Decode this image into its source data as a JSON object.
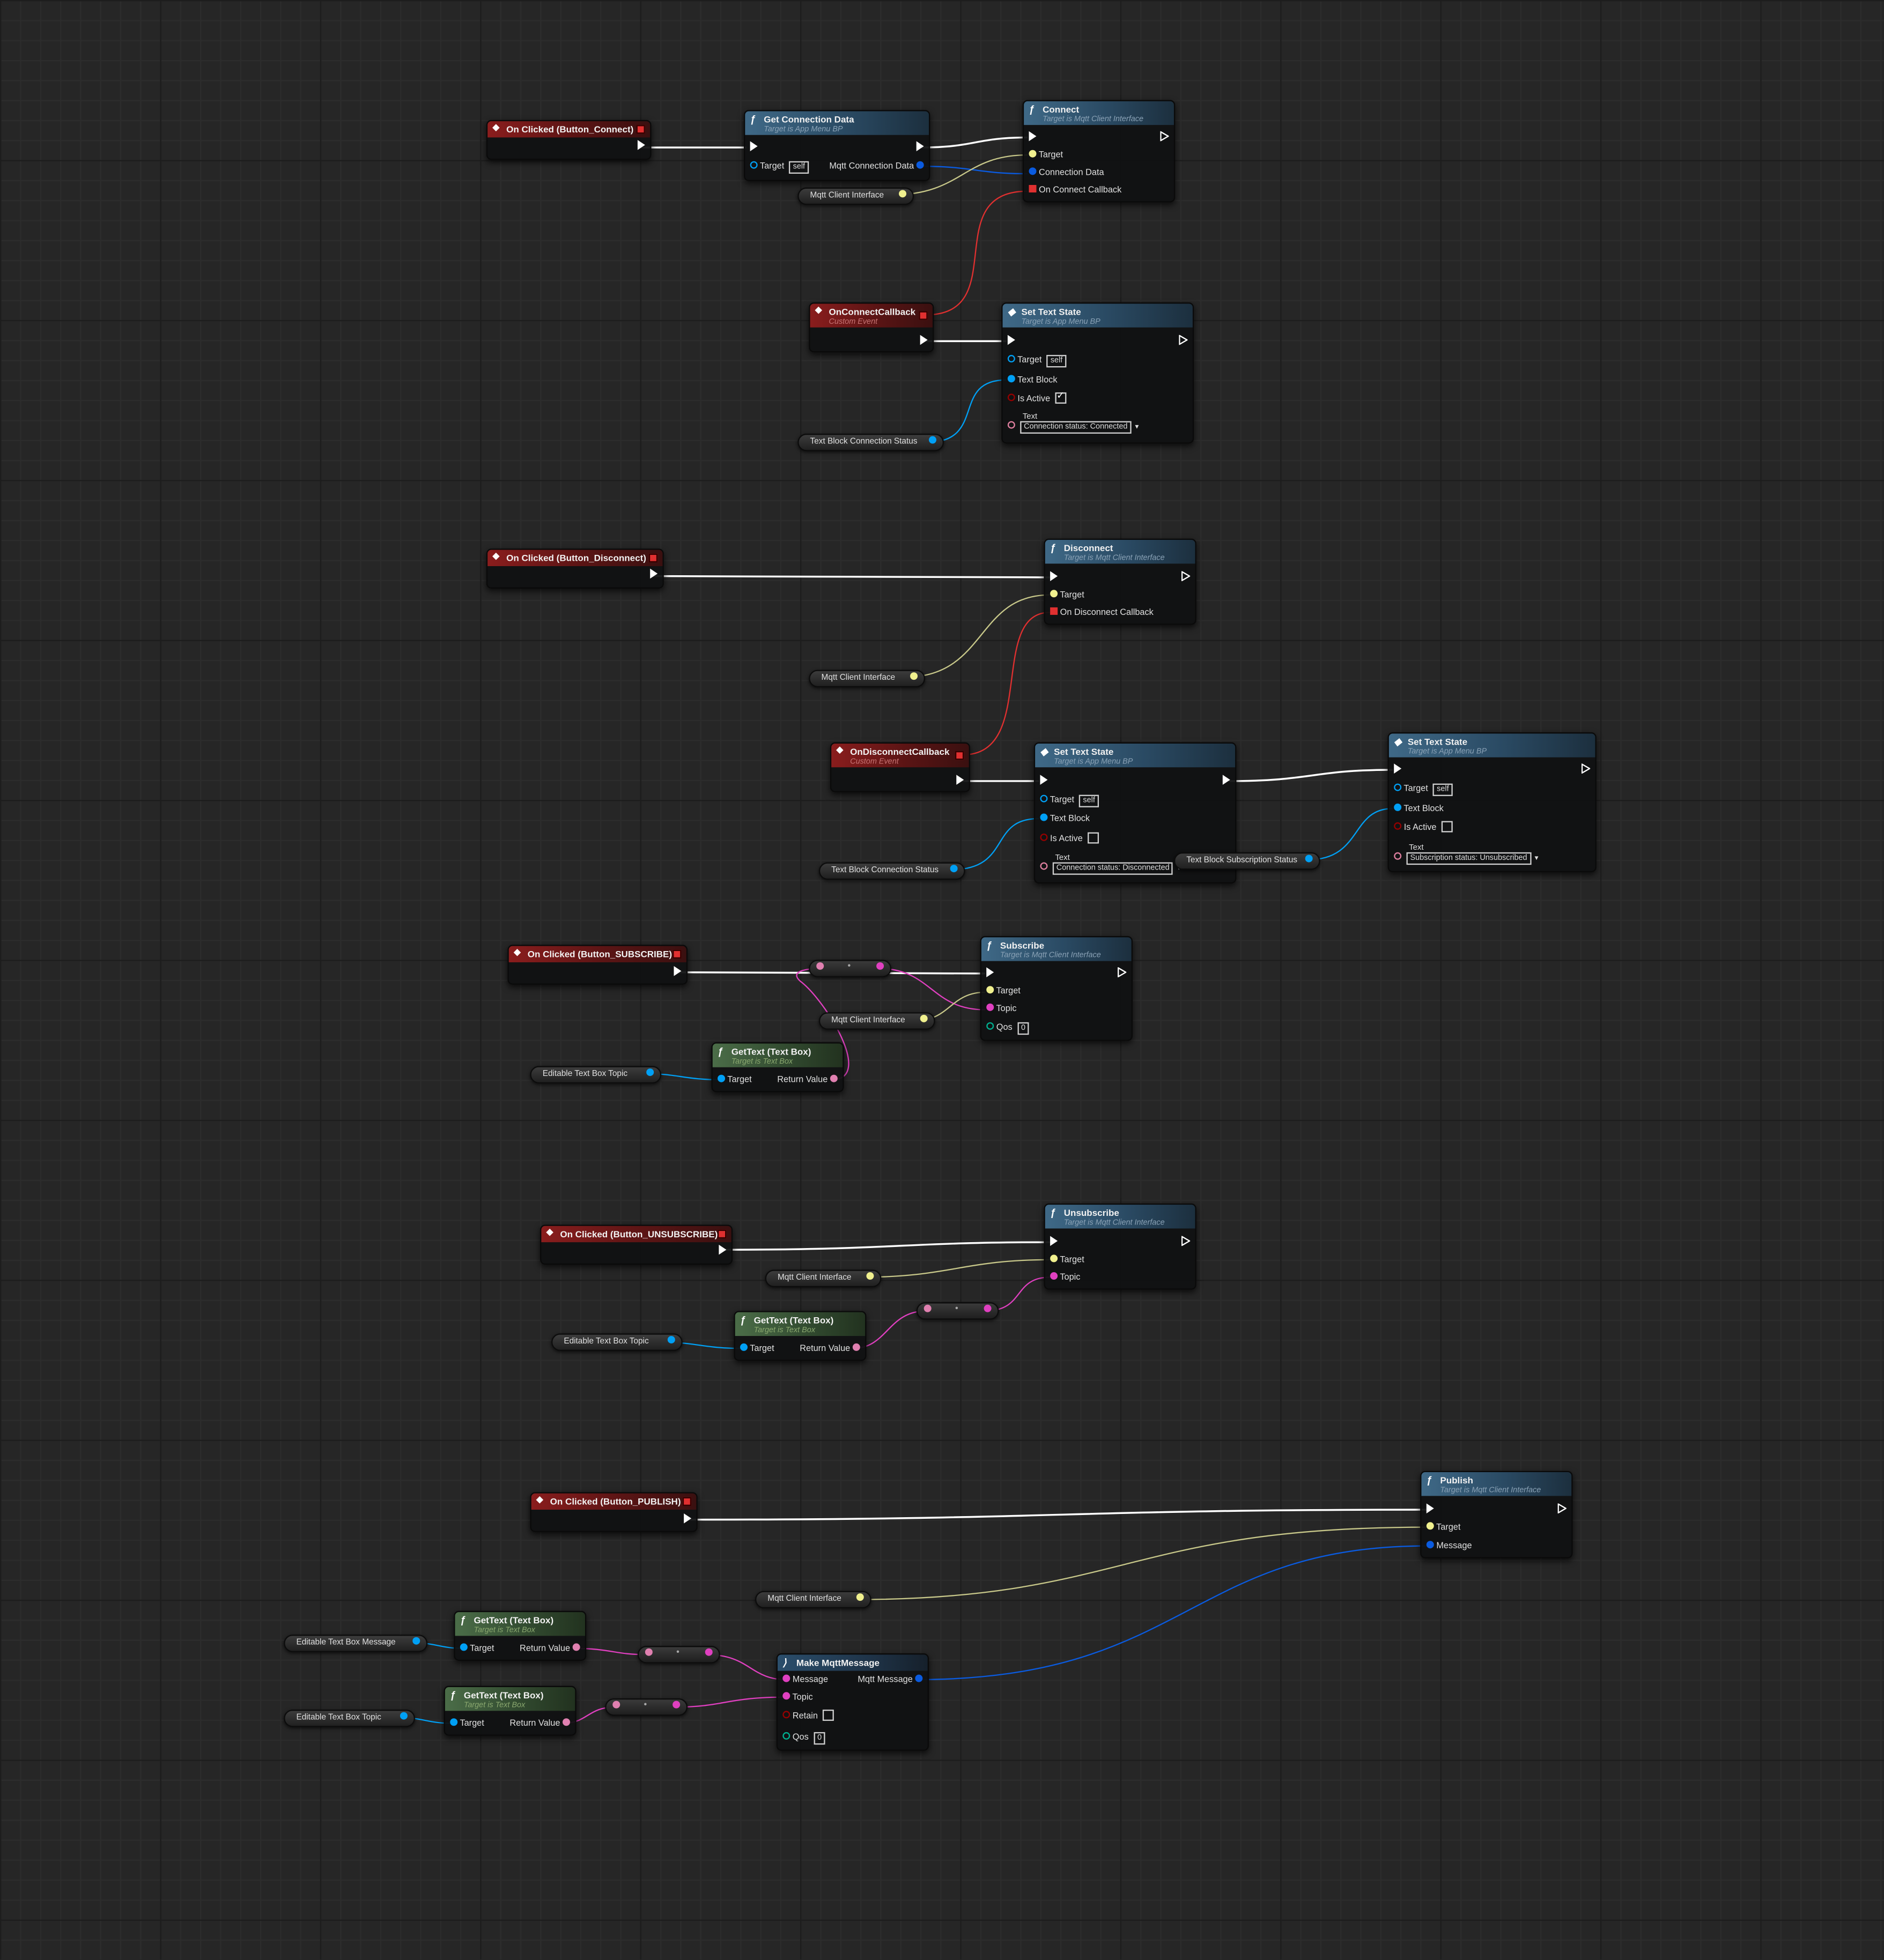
{
  "colors": {
    "exec": "#ffffff",
    "object": "#00a0f5",
    "interface": "#f0f08e",
    "struct": "#0a5be0",
    "delegate": "#e03030",
    "text": "#e040c0",
    "bool": "#950000",
    "byte": "#006060"
  },
  "nodes": {
    "ev_connect": {
      "title": "On Clicked (Button_Connect)"
    },
    "get_conn": {
      "title": "Get Connection Data",
      "subtitle": "Target is App Menu BP",
      "target": "Target",
      "self": "self",
      "out": "Mqtt Connection Data"
    },
    "connect": {
      "title": "Connect",
      "subtitle": "Target is Mqtt Client Interface",
      "p1": "Target",
      "p2": "Connection Data",
      "p3": "On Connect Callback"
    },
    "var_mci_1": {
      "label": "Mqtt Client Interface"
    },
    "ev_onconnectcb": {
      "title": "OnConnectCallback",
      "subtitle": "Custom Event"
    },
    "sts1": {
      "title": "Set Text State",
      "subtitle": "Target is App Menu BP",
      "target": "Target",
      "self": "self",
      "tb": "Text Block",
      "active": "Is Active",
      "text": "Text",
      "value": "Connection status: Connected"
    },
    "var_tbcs_1": {
      "label": "Text Block Connection Status"
    },
    "ev_disconnect": {
      "title": "On Clicked (Button_Disconnect)"
    },
    "disconnect": {
      "title": "Disconnect",
      "subtitle": "Target is Mqtt Client Interface",
      "p1": "Target",
      "p2": "On Disconnect Callback"
    },
    "var_mci_2": {
      "label": "Mqtt Client Interface"
    },
    "ev_ondisconnectcb": {
      "title": "OnDisconnectCallback",
      "subtitle": "Custom Event"
    },
    "sts2": {
      "title": "Set Text State",
      "subtitle": "Target is App Menu BP",
      "target": "Target",
      "self": "self",
      "tb": "Text Block",
      "active": "Is Active",
      "text": "Text",
      "value": "Connection status: Disconnected"
    },
    "sts3": {
      "title": "Set Text State",
      "subtitle": "Target is App Menu BP",
      "target": "Target",
      "self": "self",
      "tb": "Text Block",
      "active": "Is Active",
      "text": "Text",
      "value": "Subscription status: Unsubscribed"
    },
    "var_tbcs_2": {
      "label": "Text Block Connection Status"
    },
    "var_tbss": {
      "label": "Text Block Subscription Status"
    },
    "ev_subscribe": {
      "title": "On Clicked (Button_SUBSCRIBE)"
    },
    "subscribe": {
      "title": "Subscribe",
      "subtitle": "Target is Mqtt Client Interface",
      "p1": "Target",
      "p2": "Topic",
      "p3": "Qos",
      "qos": "0"
    },
    "var_mci_3": {
      "label": "Mqtt Client Interface"
    },
    "gettext1": {
      "title": "GetText (Text Box)",
      "subtitle": "Target is Text Box",
      "target": "Target",
      "out": "Return Value"
    },
    "var_etbt_1": {
      "label": "Editable Text Box Topic"
    },
    "ev_unsubscribe": {
      "title": "On Clicked (Button_UNSUBSCRIBE)"
    },
    "unsubscribe": {
      "title": "Unsubscribe",
      "subtitle": "Target is Mqtt Client Interface",
      "p1": "Target",
      "p2": "Topic"
    },
    "var_mci_4": {
      "label": "Mqtt Client Interface"
    },
    "gettext2": {
      "title": "GetText (Text Box)",
      "subtitle": "Target is Text Box",
      "target": "Target",
      "out": "Return Value"
    },
    "var_etbt_2": {
      "label": "Editable Text Box Topic"
    },
    "ev_publish": {
      "title": "On Clicked (Button_PUBLISH)"
    },
    "publish": {
      "title": "Publish",
      "subtitle": "Target is Mqtt Client Interface",
      "p1": "Target",
      "p2": "Message"
    },
    "var_mci_5": {
      "label": "Mqtt Client Interface"
    },
    "gettext3": {
      "title": "GetText (Text Box)",
      "subtitle": "Target is Text Box",
      "target": "Target",
      "out": "Return Value"
    },
    "var_etbm": {
      "label": "Editable Text Box Message"
    },
    "gettext4": {
      "title": "GetText (Text Box)",
      "subtitle": "Target is Text Box",
      "target": "Target",
      "out": "Return Value"
    },
    "var_etbt_3": {
      "label": "Editable Text Box Topic"
    },
    "make_msg": {
      "title": "Make MqttMessage",
      "in1": "Message",
      "in2": "Topic",
      "in3": "Retain",
      "in4": "Qos",
      "qos": "0",
      "out": "Mqtt Message"
    }
  }
}
